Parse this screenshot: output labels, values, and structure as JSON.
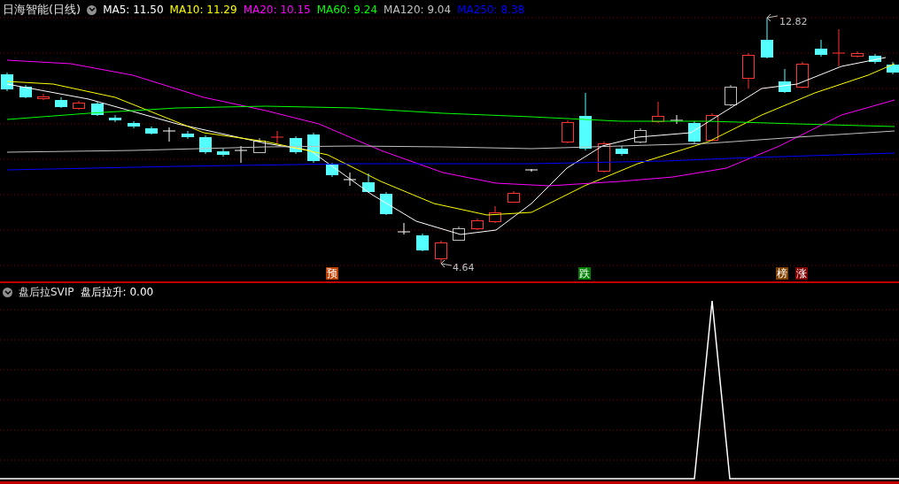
{
  "main_panel": {
    "stock_title": "日海智能(日线)",
    "moving_averages": [
      {
        "label": "MA5: 11.50",
        "color": "#ffffff"
      },
      {
        "label": "MA10: 11.29",
        "color": "#ffff00"
      },
      {
        "label": "MA20: 10.15",
        "color": "#ff00ff"
      },
      {
        "label": "MA60: 9.24",
        "color": "#00ff00"
      },
      {
        "label": "MA120: 9.04",
        "color": "#c0c0c0"
      },
      {
        "label": "MA250: 8.38",
        "color": "#0000ff"
      }
    ],
    "high_label": "12.82",
    "low_label": "4.64",
    "signal_tags": [
      {
        "text": "预",
        "color": "#c04000"
      },
      {
        "text": "跌",
        "color": "#008000"
      },
      {
        "text": "榜",
        "color": "#804000"
      },
      {
        "text": "涨",
        "color": "#800000"
      }
    ]
  },
  "indicator_panel": {
    "name": "盘后拉SVIP",
    "reading": "盘后拉升: 0.00"
  }
}
